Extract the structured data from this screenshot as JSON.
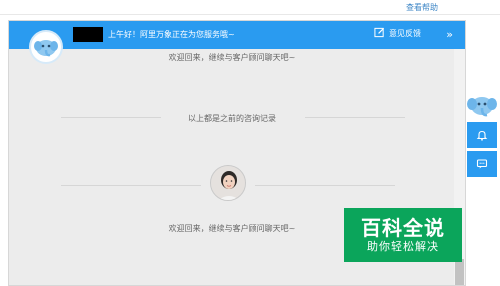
{
  "page": {
    "help_link": "查看帮助"
  },
  "header": {
    "greeting": "上午好！阿里万象正在为您服务哦~",
    "feedback_label": "意见反馈",
    "collapse_glyph": "»"
  },
  "chat": {
    "welcome_top": "欢迎回来，继续与客户顾问聊天吧~",
    "history_divider": "以上都是之前的咨询记录",
    "welcome_bottom": "欢迎回来，继续与客户顾问聊天吧~"
  },
  "watermark": {
    "main": "百科全说",
    "sub": "助你轻松解决"
  },
  "colors": {
    "accent": "#2a9bf0",
    "panel_bg": "#ececec",
    "watermark_green": "#0ba55b"
  },
  "icons": {
    "feedback": "edit-icon",
    "bell": "bell-icon",
    "chat": "chat-icon",
    "mascot": "elephant-mascot-icon"
  }
}
